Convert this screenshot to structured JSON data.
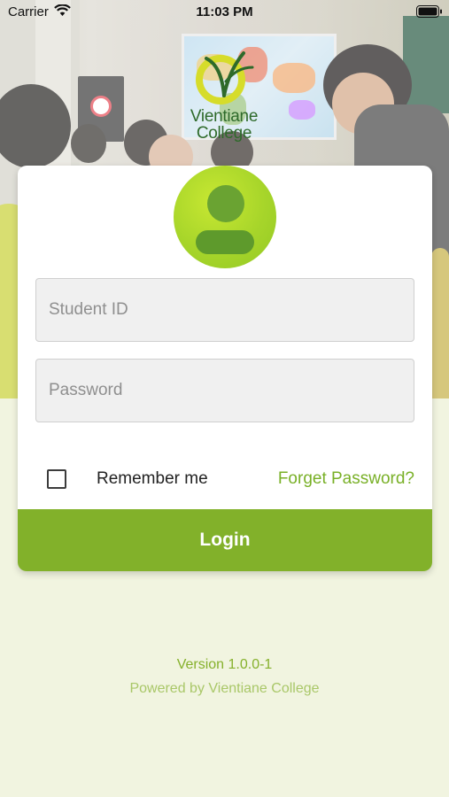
{
  "status_bar": {
    "carrier": "Carrier",
    "time": "11:03 PM",
    "wifi_icon": "wifi-icon",
    "battery_icon": "battery-icon"
  },
  "brand": {
    "logo_line1": "Vientiane",
    "logo_line2": "College",
    "primary_color": "#82b12a",
    "background_color": "#f1f4e0"
  },
  "login_form": {
    "avatar_icon": "user-avatar-icon",
    "student_id": {
      "placeholder": "Student ID",
      "value": ""
    },
    "password": {
      "placeholder": "Password",
      "value": ""
    },
    "remember_me": {
      "label": "Remember me",
      "checked": false
    },
    "forgot_password_label": "Forget Password?",
    "login_label": "Login"
  },
  "footer": {
    "version": "Version 1.0.0-1",
    "powered_by": "Powered by Vientiane College"
  }
}
